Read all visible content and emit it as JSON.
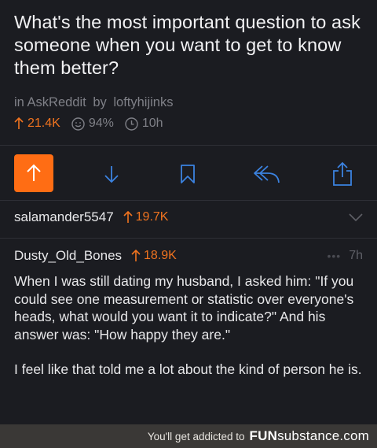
{
  "post": {
    "title": "What's the most important question to ask someone when you want to get to know them better?",
    "subreddit_prefix": "in",
    "subreddit": "AskReddit",
    "by_prefix": "by",
    "author": "loftyhijinks",
    "score": "21.4K",
    "upvote_ratio": "94%",
    "age": "10h"
  },
  "actions": [
    "upvote-icon",
    "downvote-icon",
    "save-icon",
    "reply-icon",
    "share-icon"
  ],
  "colors": {
    "accent": "#ff6d14",
    "background": "#1b1c21",
    "muted": "#7f8087"
  },
  "collapsed_comment": {
    "username": "salamander5547",
    "score": "19.7K"
  },
  "comment": {
    "username": "Dusty_Old_Bones",
    "score": "18.9K",
    "more": "•••",
    "age": "7h",
    "paragraphs": [
      "When I was still dating my husband, I asked him: \"If you could see one measurement or statistic over everyone's heads, what would you want it to indicate?\" And his answer was: \"How happy they are.\"",
      "I feel like that told me a lot about the kind of person he is."
    ]
  },
  "footer": {
    "tagline": "You'll get addicted to",
    "brand_bold": "FUN",
    "brand_rest": "substance.com"
  }
}
